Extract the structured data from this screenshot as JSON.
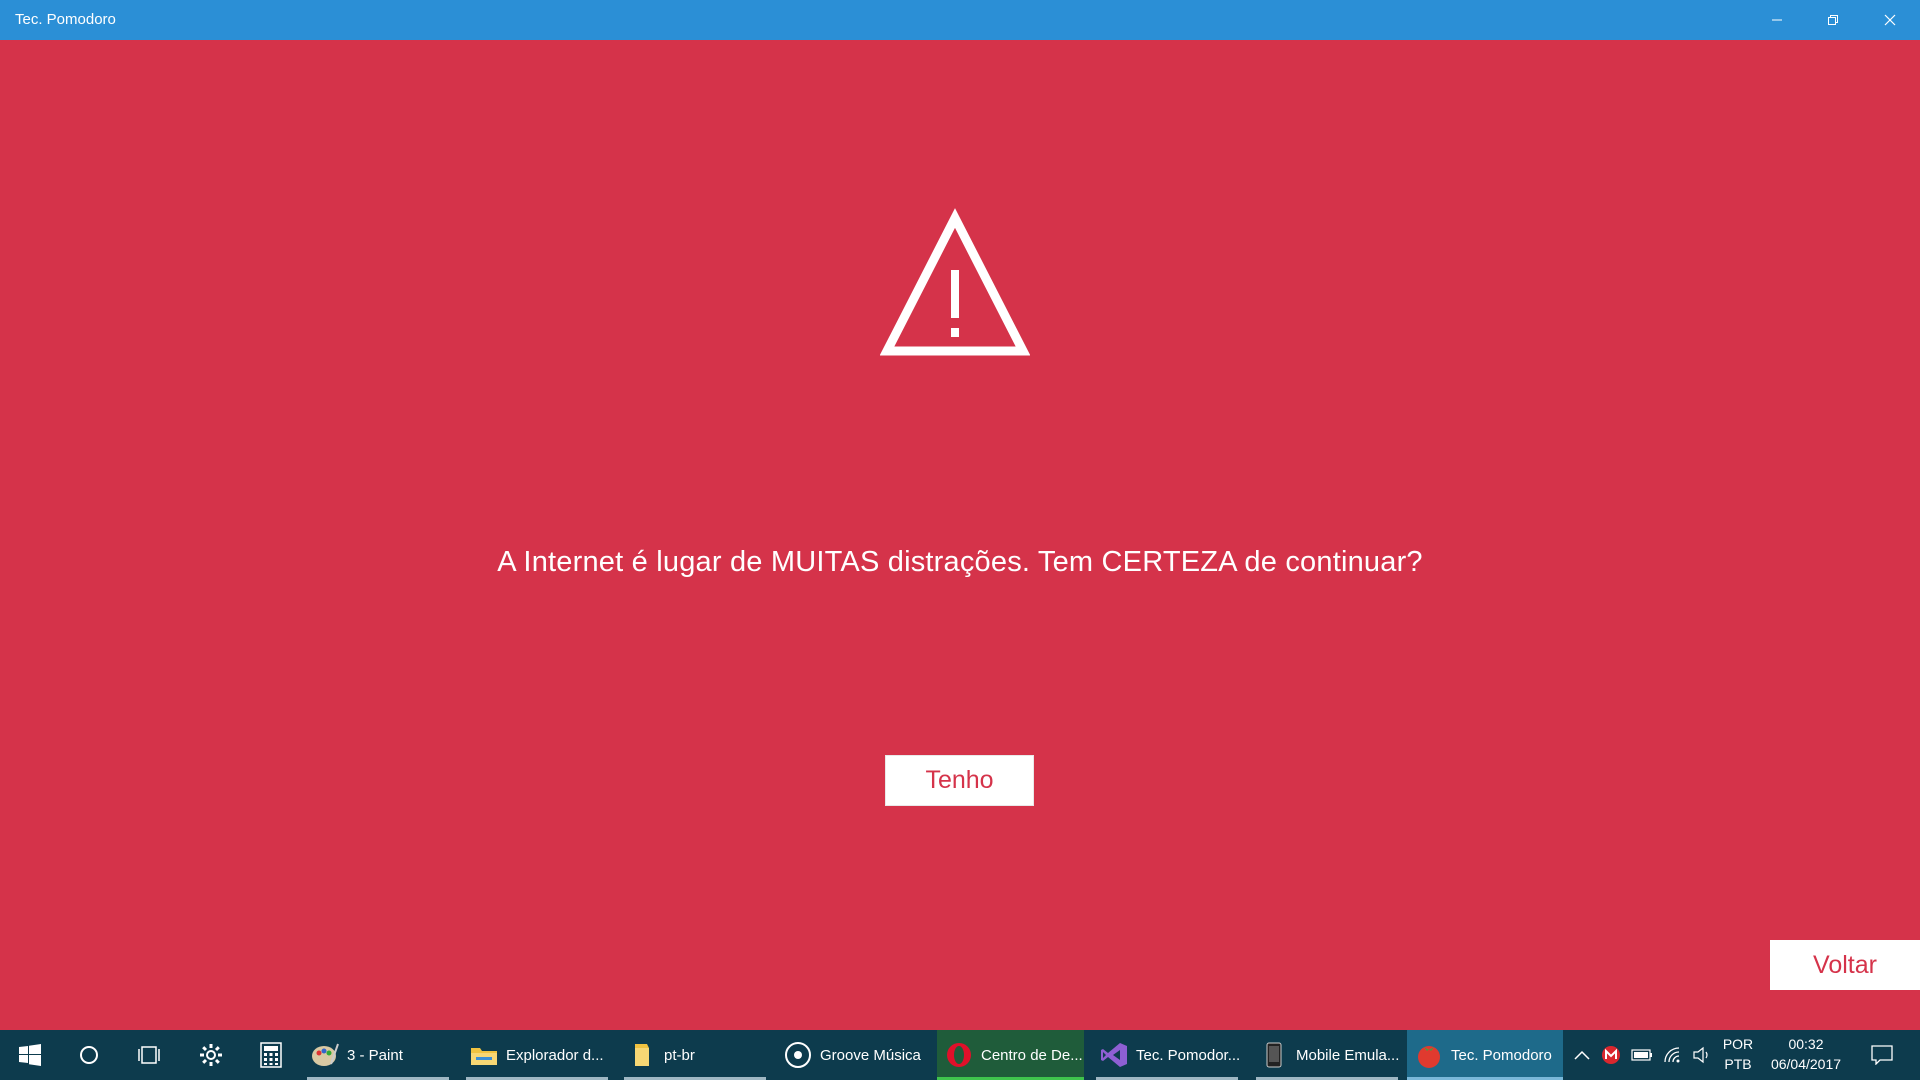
{
  "window": {
    "title": "Tec. Pomodoro"
  },
  "content": {
    "message": "A Internet é lugar de MUITAS distrações. Tem CERTEZA de continuar?",
    "confirm_label": "Tenho",
    "back_label": "Voltar"
  },
  "colors": {
    "background": "#d5334a",
    "titlebar": "#2b8fd6",
    "taskbar": "#0d3b4d"
  },
  "taskbar": {
    "apps": [
      {
        "label": "3 - Paint",
        "icon": "paint-icon"
      },
      {
        "label": "Explorador d...",
        "icon": "folder-icon"
      },
      {
        "label": "pt-br",
        "icon": "folder-icon"
      },
      {
        "label": "Groove Música",
        "icon": "groove-icon"
      },
      {
        "label": "Centro de De...",
        "icon": "opera-icon"
      },
      {
        "label": "Tec. Pomodor...",
        "icon": "visual-studio-icon"
      },
      {
        "label": "Mobile Emula...",
        "icon": "phone-icon"
      },
      {
        "label": "Tec. Pomodoro",
        "icon": "tomato-icon"
      }
    ],
    "lang_line1": "POR",
    "lang_line2": "PTB",
    "time": "00:32",
    "date": "06/04/2017"
  }
}
